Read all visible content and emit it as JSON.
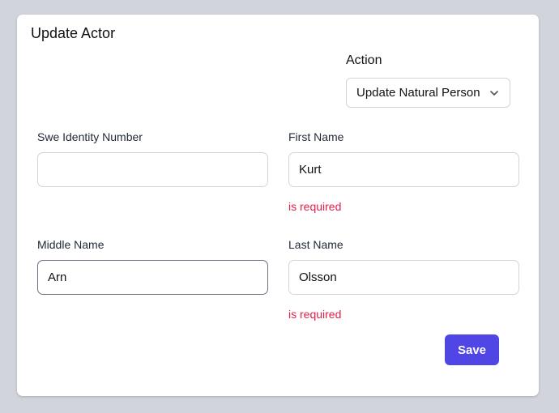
{
  "form": {
    "title": "Update Actor",
    "action": {
      "label": "Action",
      "selected": "Update Natural Person"
    },
    "fields": {
      "swe_identity_number": {
        "label": "Swe Identity Number",
        "value": ""
      },
      "first_name": {
        "label": "First Name",
        "value": "Kurt",
        "error": "is required"
      },
      "middle_name": {
        "label": "Middle Name",
        "value": "Arn"
      },
      "last_name": {
        "label": "Last Name",
        "value": "Olsson",
        "error": "is required"
      }
    },
    "save_label": "Save"
  },
  "colors": {
    "accent": "#4f46e5",
    "error": "#e11d48",
    "page_background": "#d1d5db"
  }
}
